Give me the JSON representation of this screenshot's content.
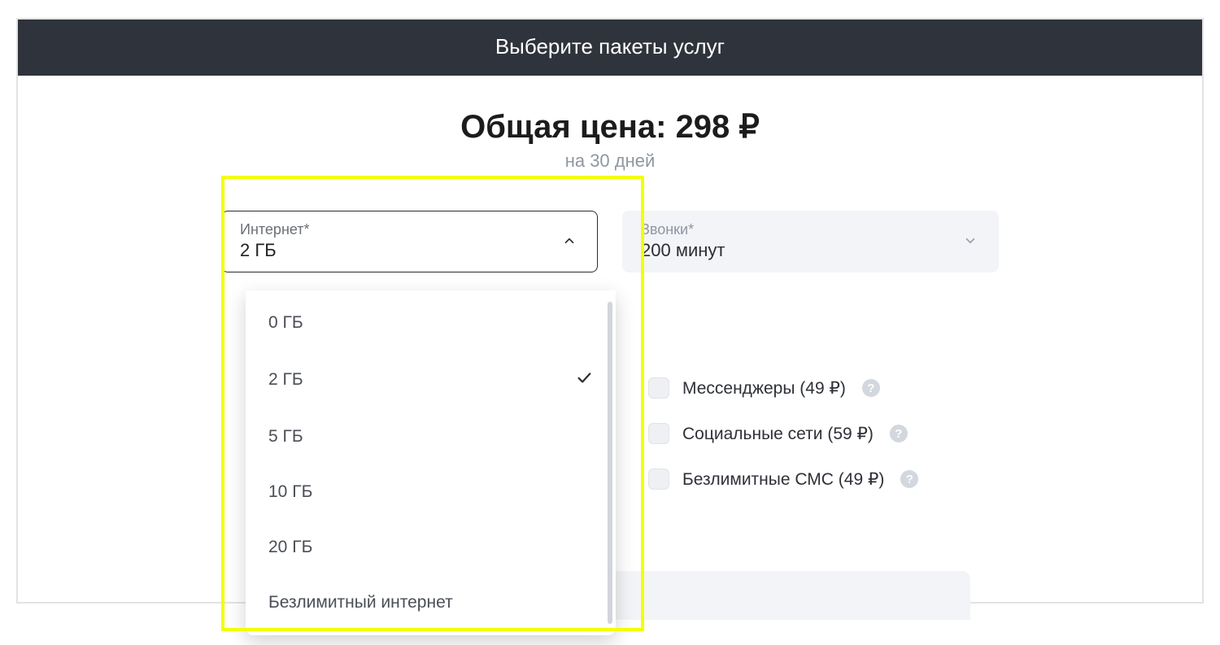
{
  "header": {
    "title": "Выберите пакеты услуг"
  },
  "price": {
    "label": "Общая цена:",
    "value": "298 ₽",
    "period": "на 30 дней"
  },
  "internet_select": {
    "label": "Интернет*",
    "value": "2 ГБ"
  },
  "calls_select": {
    "label": "Звонки*",
    "value": "200 минут"
  },
  "internet_options": [
    {
      "label": "0 ГБ",
      "selected": false
    },
    {
      "label": "2 ГБ",
      "selected": true
    },
    {
      "label": "5 ГБ",
      "selected": false
    },
    {
      "label": "10 ГБ",
      "selected": false
    },
    {
      "label": "20 ГБ",
      "selected": false
    },
    {
      "label": "Безлимитный интернет",
      "selected": false
    }
  ],
  "addons": [
    {
      "label": "Мессенджеры (49 ₽)"
    },
    {
      "label": "Социальные сети (59 ₽)"
    },
    {
      "label": "Безлимитные СМС (49 ₽)"
    }
  ],
  "help_symbol": "?",
  "colors": {
    "highlight": "#f2ff00",
    "header_bg": "#2f333b",
    "panel_bg": "#f2f4f7"
  }
}
